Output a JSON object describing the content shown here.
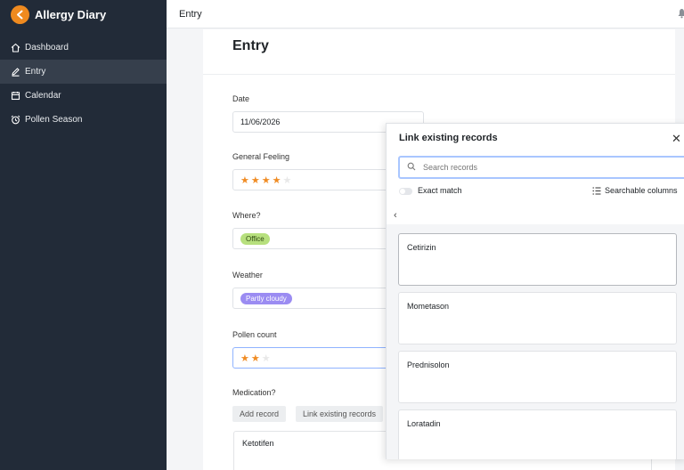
{
  "app": {
    "title": "Allergy Diary",
    "accent": "#ef8a1f"
  },
  "sidebar": {
    "items": [
      {
        "label": "Dashboard",
        "icon": "home-icon"
      },
      {
        "label": "Entry",
        "icon": "edit-icon",
        "active": true
      },
      {
        "label": "Calendar",
        "icon": "calendar-icon"
      },
      {
        "label": "Pollen Season",
        "icon": "alarm-clock-icon"
      }
    ]
  },
  "topbar": {
    "title": "Entry"
  },
  "form": {
    "title": "Entry",
    "date": {
      "label": "Date",
      "value": "11/06/2026"
    },
    "feeling": {
      "label": "General Feeling",
      "rating": 4,
      "max": 5
    },
    "where": {
      "label": "Where?",
      "tag": "Office",
      "tag_color": "#b7e07e"
    },
    "weather": {
      "label": "Weather",
      "tag": "Partly cloudy",
      "tag_color": "#9b8cf2"
    },
    "pollen": {
      "label": "Pollen count",
      "rating": 2,
      "max": 3
    },
    "medication": {
      "label": "Medication?",
      "add_label": "Add record",
      "link_label": "Link existing records",
      "linked_record": "Ketotifen"
    }
  },
  "modal": {
    "title": "Link existing records",
    "search_placeholder": "Search records",
    "exact_match_label": "Exact match",
    "searchable_columns_label": "Searchable columns",
    "records": [
      "Cetirizin",
      "Mometason",
      "Prednisolon",
      "Loratadin"
    ]
  }
}
